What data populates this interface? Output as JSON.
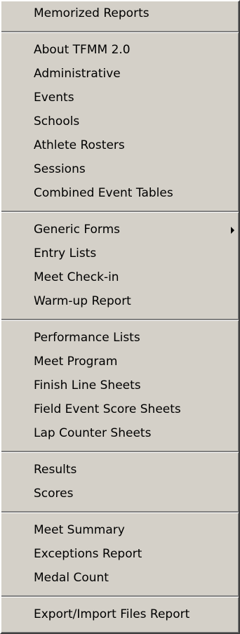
{
  "menu": {
    "groups": [
      [
        "Memorized Reports"
      ],
      [
        "About TFMM 2.0",
        "Administrative",
        "Events",
        "Schools",
        "Athlete Rosters",
        "Sessions",
        "Combined Event Tables"
      ],
      [
        "Generic Forms",
        "Entry Lists",
        "Meet Check-in",
        "Warm-up Report"
      ],
      [
        "Performance Lists",
        "Meet Program",
        "Finish Line Sheets",
        "Field Event Score Sheets",
        "Lap Counter Sheets"
      ],
      [
        "Results",
        "Scores"
      ],
      [
        "Meet Summary",
        "Exceptions Report",
        "Medal Count"
      ],
      [
        "Export/Import Files Report"
      ]
    ],
    "submenu_items": [
      "Generic Forms"
    ],
    "icons": {
      "submenu": "triangle-right-icon"
    }
  }
}
